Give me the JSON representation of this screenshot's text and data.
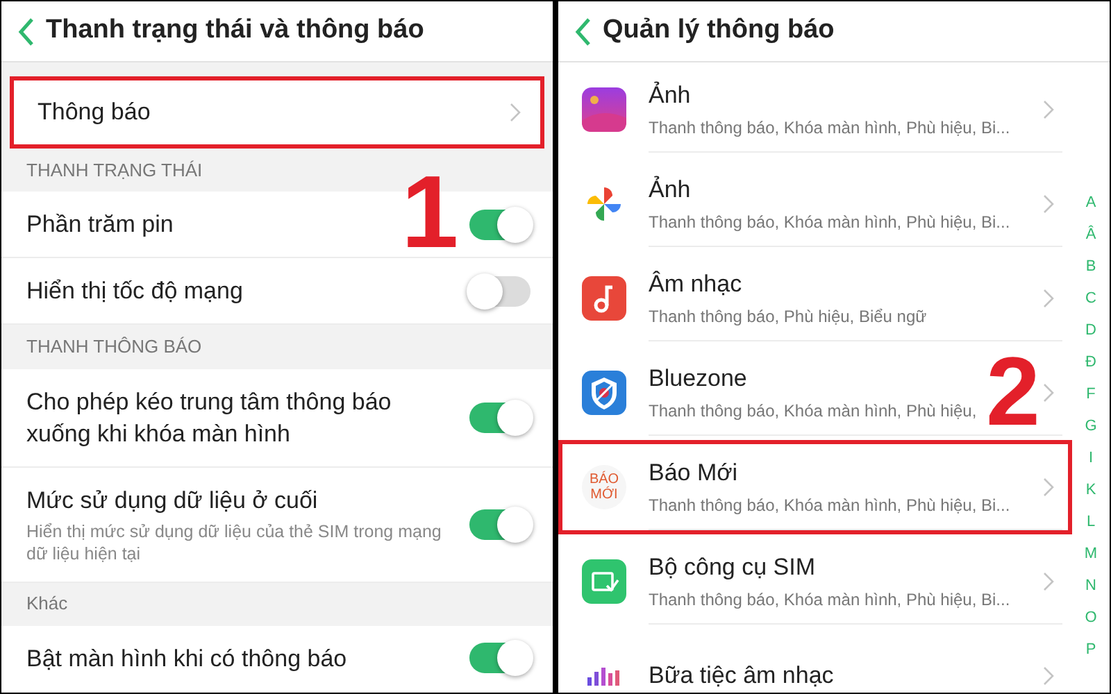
{
  "left_screen": {
    "title": "Thanh trạng thái và thông báo",
    "items": [
      {
        "kind": "link",
        "label": "Thông báo",
        "highlighted": true
      },
      {
        "kind": "section",
        "label": "THANH TRẠNG THÁI"
      },
      {
        "kind": "toggle",
        "label": "Phần trăm pin",
        "on": true
      },
      {
        "kind": "toggle",
        "label": "Hiển thị tốc độ mạng",
        "on": false
      },
      {
        "kind": "section",
        "label": "THANH THÔNG BÁO"
      },
      {
        "kind": "toggle",
        "label": "Cho phép kéo trung tâm thông báo xuống khi khóa màn hình",
        "on": true
      },
      {
        "kind": "toggle",
        "label": "Mức sử dụng dữ liệu ở cuối",
        "description": "Hiển thị mức sử dụng dữ liệu của thẻ SIM trong mạng dữ liệu hiện tại",
        "on": true
      },
      {
        "kind": "section",
        "label": "Khác"
      },
      {
        "kind": "toggle",
        "label": "Bật màn hình khi có thông báo",
        "on": true
      }
    ],
    "annotation": "1"
  },
  "right_screen": {
    "title": "Quản lý thông báo",
    "apps": [
      {
        "kind": "gallery",
        "name": "Ảnh",
        "detail": "Thanh thông báo, Khóa màn hình, Phù hiệu, Bi...",
        "highlighted": false
      },
      {
        "kind": "pinwheel",
        "name": "Ảnh",
        "detail": "Thanh thông báo, Khóa màn hình, Phù hiệu, Bi...",
        "highlighted": false
      },
      {
        "kind": "music",
        "name": "Âm nhạc",
        "detail": "Thanh thông báo, Phù hiệu, Biểu ngữ",
        "highlighted": false
      },
      {
        "kind": "shield",
        "name": "Bluezone",
        "detail": "Thanh thông báo, Khóa màn hình, Phù hiệu,",
        "highlighted": false,
        "annotation": "2"
      },
      {
        "kind": "logo",
        "icon_text": [
          "BÁO",
          "MỚI"
        ],
        "name": "Báo Mới",
        "detail": "Thanh thông báo, Khóa màn hình, Phù hiệu, Bi...",
        "highlighted": true
      },
      {
        "kind": "sim",
        "name": "Bộ công cụ SIM",
        "detail": "Thanh thông báo, Khóa màn hình, Phù hiệu, Bi...",
        "highlighted": false
      },
      {
        "kind": "bars",
        "name": "Bữa tiệc âm nhạc",
        "highlighted": false
      }
    ],
    "index": [
      "A",
      "Â",
      "B",
      "C",
      "D",
      "Đ",
      "F",
      "G",
      "I",
      "K",
      "L",
      "M",
      "N",
      "O",
      "P"
    ]
  }
}
